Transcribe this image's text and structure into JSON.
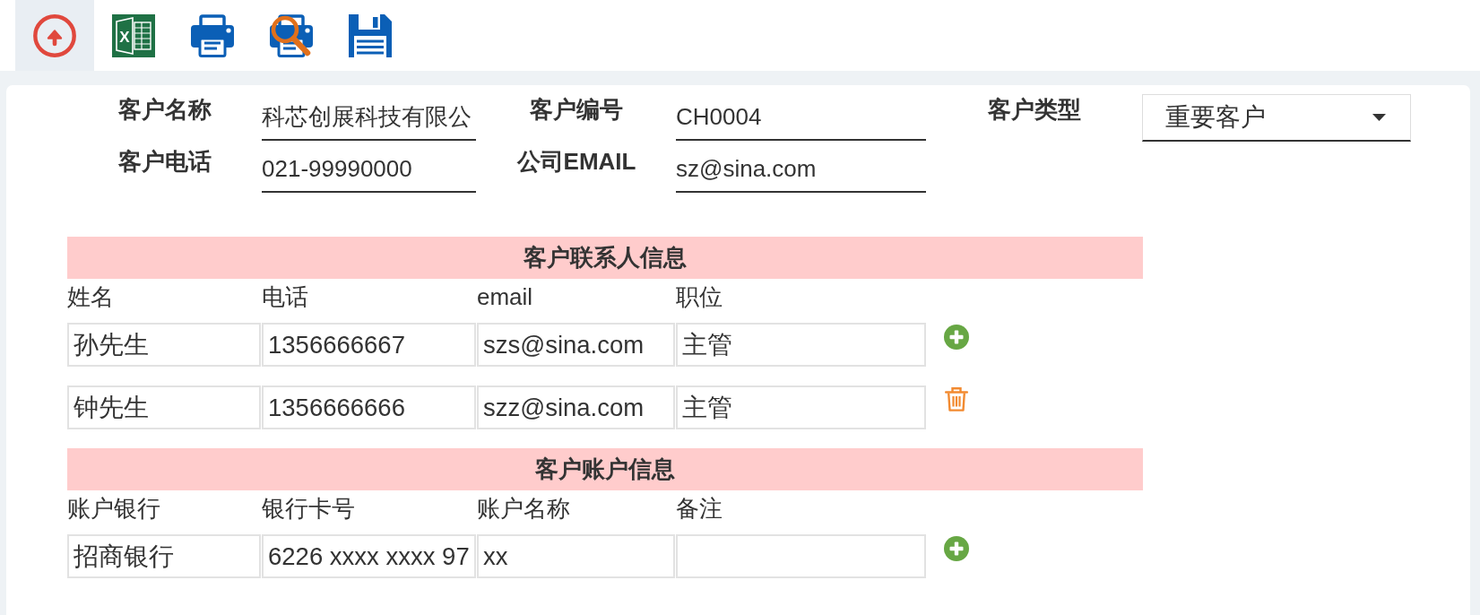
{
  "toolbar": [
    {
      "kind": "upload",
      "selected": true
    },
    {
      "kind": "excel",
      "letter": "X",
      "selected": false
    },
    {
      "kind": "print",
      "selected": false
    },
    {
      "kind": "print_preview",
      "selected": false
    },
    {
      "kind": "save",
      "selected": false
    }
  ],
  "customer_form": {
    "fields": [
      {
        "kind": "text",
        "label": "客户名称",
        "value": "科芯创展科技有限公"
      },
      {
        "kind": "text",
        "label": "客户编号",
        "value": "CH0004"
      },
      {
        "kind": "select",
        "label": "客户类型",
        "value": "重要客户"
      },
      {
        "kind": "text",
        "label": "客户电话",
        "value": "021-99990000"
      },
      {
        "kind": "text",
        "label": "公司EMAIL",
        "value": "sz@sina.com"
      }
    ]
  },
  "contacts": {
    "title": "客户联系人信息",
    "columns": [
      "姓名",
      "电话",
      "email",
      "职位"
    ],
    "rows": [
      {
        "kind": "add",
        "cells": [
          "孙先生",
          "1356666667",
          "szs@sina.com",
          "主管"
        ]
      },
      {
        "kind": "delete",
        "cells": [
          "钟先生",
          "1356666666",
          "szz@sina.com",
          "主管"
        ]
      }
    ]
  },
  "accounts": {
    "title": "客户账户信息",
    "columns": [
      "账户银行",
      "银行卡号",
      "账户名称",
      "备注"
    ],
    "rows": [
      {
        "kind": "add",
        "cells": [
          "招商银行",
          "6226 xxxx xxxx 97",
          "xx"
        ]
      }
    ]
  }
}
